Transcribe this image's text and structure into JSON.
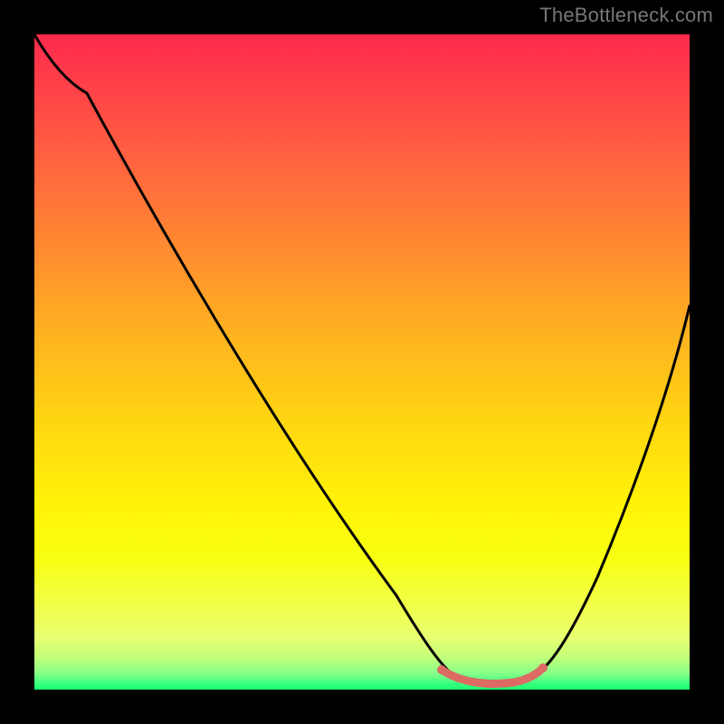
{
  "watermark": "TheBottleneck.com",
  "colors": {
    "background": "#000000",
    "gradient_top": "#ff2a4d",
    "gradient_mid": "#ffd312",
    "gradient_bottom": "#1aff70",
    "curve_main": "#000000",
    "curve_highlight": "#e06666"
  },
  "chart_data": {
    "type": "line",
    "title": "",
    "xlabel": "",
    "ylabel": "",
    "xlim": [
      0,
      100
    ],
    "ylim": [
      0,
      100
    ],
    "grid": false,
    "legend": false,
    "series": [
      {
        "name": "bottleneck-curve",
        "x": [
          0,
          4,
          8,
          15,
          25,
          35,
          45,
          55,
          62,
          64,
          67,
          73,
          76,
          78,
          82,
          88,
          94,
          100
        ],
        "values": [
          100,
          96,
          93,
          84,
          70,
          56,
          42,
          28,
          12,
          6,
          2,
          2,
          4,
          8,
          16,
          28,
          42,
          60
        ]
      },
      {
        "name": "optimal-range-highlight",
        "x": [
          62,
          64,
          67,
          73,
          76,
          78
        ],
        "values": [
          4,
          2.5,
          1.8,
          1.8,
          2.5,
          4
        ]
      }
    ],
    "annotations": []
  }
}
